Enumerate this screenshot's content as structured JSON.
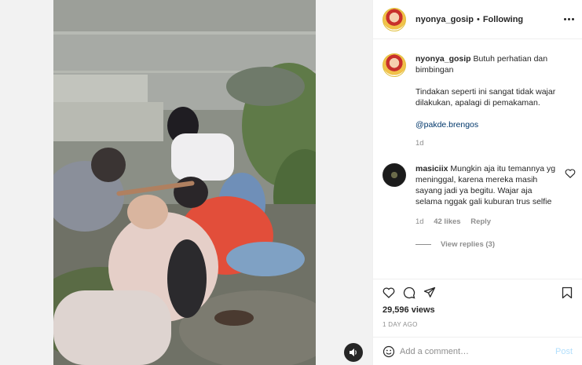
{
  "post": {
    "username": "nyonya_gosip",
    "following_label": "Following",
    "separator": "•"
  },
  "caption": {
    "username": "nyonya_gosip",
    "line1": "Butuh perhatian dan bimbingan",
    "line2": "Tindakan seperti ini sangat tidak wajar dilakukan, apalagi di pemakaman.",
    "mention": "@pakde.brengos",
    "time": "1d"
  },
  "comments": [
    {
      "username": "masiciix",
      "text": "Mungkin aja itu temannya yg meninggal, karena mereka masih sayang jadi ya begitu. Wajar aja selama nggak gali kuburan trus selfie",
      "time": "1d",
      "likes": "42 likes",
      "reply_label": "Reply",
      "view_replies": "View replies (3)"
    }
  ],
  "stats": {
    "views": "29,596 views",
    "posted": "1 DAY AGO"
  },
  "composer": {
    "placeholder": "Add a comment…",
    "post_label": "Post"
  },
  "icons": {
    "more": "more-options-icon",
    "heart": "heart-icon",
    "comment": "comment-icon",
    "share": "share-icon",
    "save": "bookmark-icon",
    "emoji": "emoji-icon",
    "sound": "speaker-icon"
  },
  "colors": {
    "mention": "#00376b",
    "muted": "#8e8e8e",
    "post_disabled": "#b2dffc"
  }
}
